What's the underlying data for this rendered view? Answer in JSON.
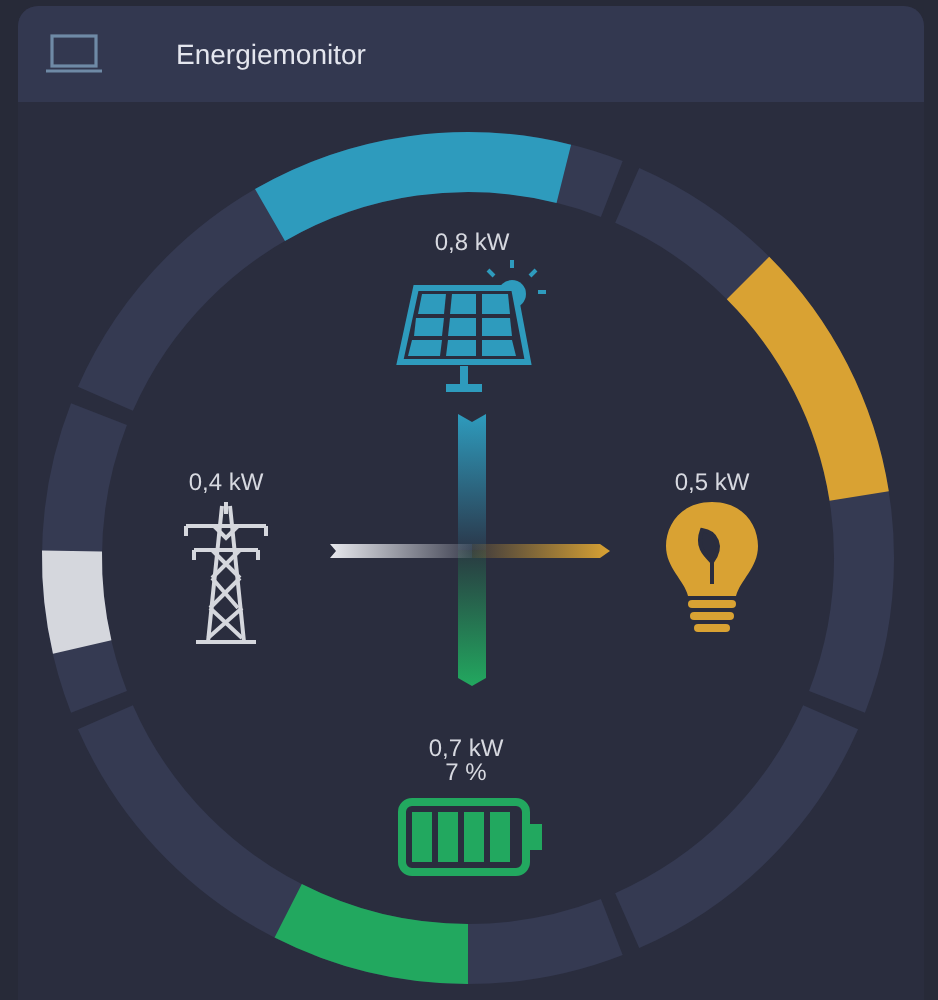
{
  "header": {
    "title": "Energiemonitor"
  },
  "nodes": [
    {
      "kind": "solar",
      "reading": "0,8 kW",
      "color": "#2e9bbd"
    },
    {
      "kind": "home",
      "reading": "0,5 kW",
      "color": "#d9a233"
    },
    {
      "kind": "battery",
      "reading": "0,7 kW",
      "percent": "7 %",
      "color": "#22a85f"
    },
    {
      "kind": "grid",
      "reading": "0,4 kW",
      "color": "#d5d7dd"
    }
  ]
}
